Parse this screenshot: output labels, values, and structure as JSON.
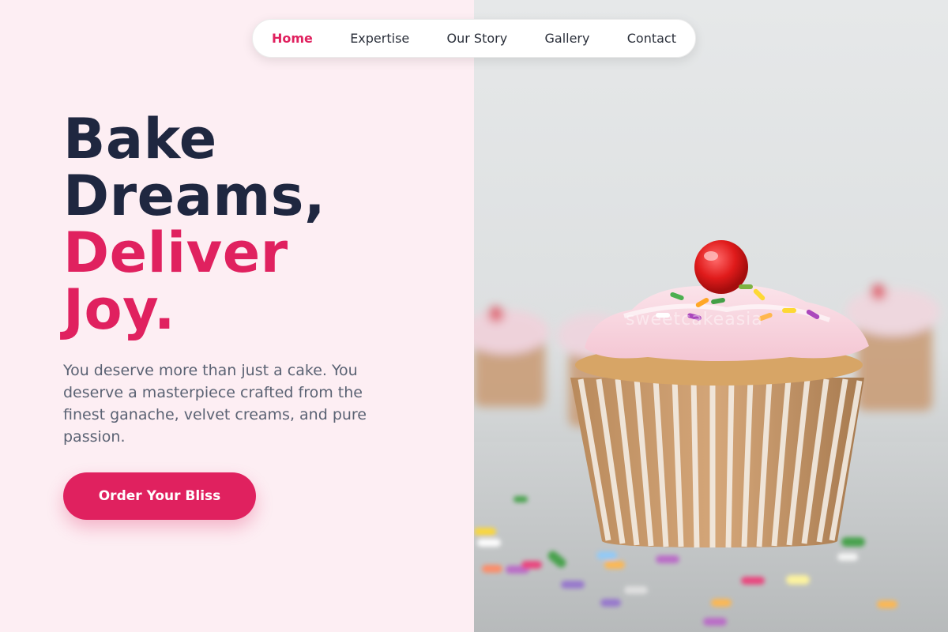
{
  "nav": {
    "items": [
      {
        "label": "Home",
        "active": true
      },
      {
        "label": "Expertise",
        "active": false
      },
      {
        "label": "Our Story",
        "active": false
      },
      {
        "label": "Gallery",
        "active": false
      },
      {
        "label": "Contact",
        "active": false
      }
    ]
  },
  "hero": {
    "headline_line1": "Bake",
    "headline_line2": "Dreams,",
    "headline_line3": "Deliver",
    "headline_line4": "Joy.",
    "subtext": "You deserve more than just a cake. You deserve a masterpiece crafted from the finest ganache, velvet creams, and pure passion.",
    "cta_label": "Order Your Bliss"
  },
  "image": {
    "watermark": "sweetcakeasia"
  },
  "colors": {
    "accent": "#e0215f",
    "headline": "#1f2740",
    "background": "#fdeef3"
  }
}
